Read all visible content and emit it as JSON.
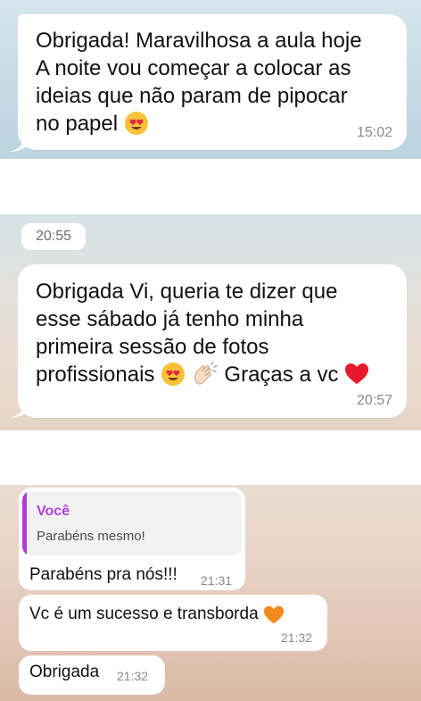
{
  "screenshot_1": {
    "message": {
      "line1": "Obrigada! Maravilhosa a aula hoje",
      "line2": "A noite vou começar a colocar as",
      "line3": "ideias que não param de pipocar",
      "line4": "no papel",
      "emoji": "heart-eyes-emoji",
      "time": "15:02"
    }
  },
  "screenshot_2": {
    "date_chip": "20:55",
    "message": {
      "line1": "Obrigada Vi, queria te dizer que",
      "line2": "esse sábado já tenho minha",
      "line3": "primeira sessão de fotos",
      "line4a": "profissionais",
      "line4b": "Graças a vc",
      "emojis": [
        "heart-eyes-emoji",
        "clapping-hands-emoji",
        "red-heart-emoji"
      ],
      "time": "20:57"
    }
  },
  "screenshot_3": {
    "reply": {
      "quote_author": "Você",
      "quote_text": "Parabéns mesmo!",
      "text": "Parabéns pra nós!!!",
      "time": "21:31"
    },
    "message_2": {
      "text": "Vc é um sucesso e transborda",
      "emoji": "orange-heart-emoji",
      "time": "21:32"
    },
    "message_3": {
      "text": "Obrigada",
      "time": "21:32"
    }
  },
  "colors": {
    "quote_accent": "#b13dd8",
    "bubble": "#ffffff",
    "timestamp": "#8a8a8a"
  }
}
